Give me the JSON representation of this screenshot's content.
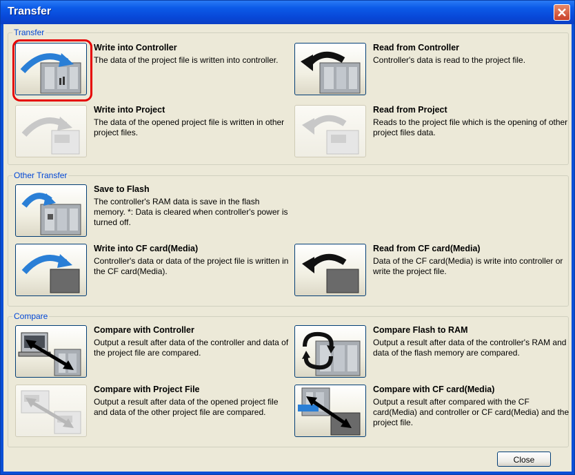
{
  "window": {
    "title": "Transfer"
  },
  "groups": {
    "transfer": "Transfer",
    "other": "Other Transfer",
    "compare": "Compare"
  },
  "items": {
    "write_controller": {
      "title": "Write into Controller",
      "desc": "The data of the project file is written into controller."
    },
    "read_controller": {
      "title": "Read from Controller",
      "desc": "Controller's data is read to the project file."
    },
    "write_project": {
      "title": "Write into Project",
      "desc": "The data of the opened project file is written in other project files."
    },
    "read_project": {
      "title": "Read from Project",
      "desc": "Reads to the project file which is the opening of other project files data."
    },
    "save_flash": {
      "title": "Save to Flash",
      "desc": "The controller's RAM data is save in the flash memory. *: Data is cleared when controller's power is turned off."
    },
    "write_cf": {
      "title": "Write into CF card(Media)",
      "desc": "Controller's data or data of the project file is written in the CF card(Media)."
    },
    "read_cf": {
      "title": "Read from CF card(Media)",
      "desc": "Data of the CF card(Media) is write into controller or write the project file."
    },
    "compare_controller": {
      "title": "Compare with Controller",
      "desc": "Output a result after data of the controller and data of the project file are compared."
    },
    "compare_flash": {
      "title": "Compare Flash to RAM",
      "desc": "Output a result after data of the controller's RAM and data of the flash memory are compared."
    },
    "compare_project": {
      "title": "Compare with Project File",
      "desc": "Output a result after data of the opened project file and data of the other project file are compared."
    },
    "compare_cf": {
      "title": "Compare with CF card(Media)",
      "desc": "Output a result after compared with the CF card(Media) and controller or CF card(Media) and the project file."
    }
  },
  "footer": {
    "close": "Close"
  }
}
